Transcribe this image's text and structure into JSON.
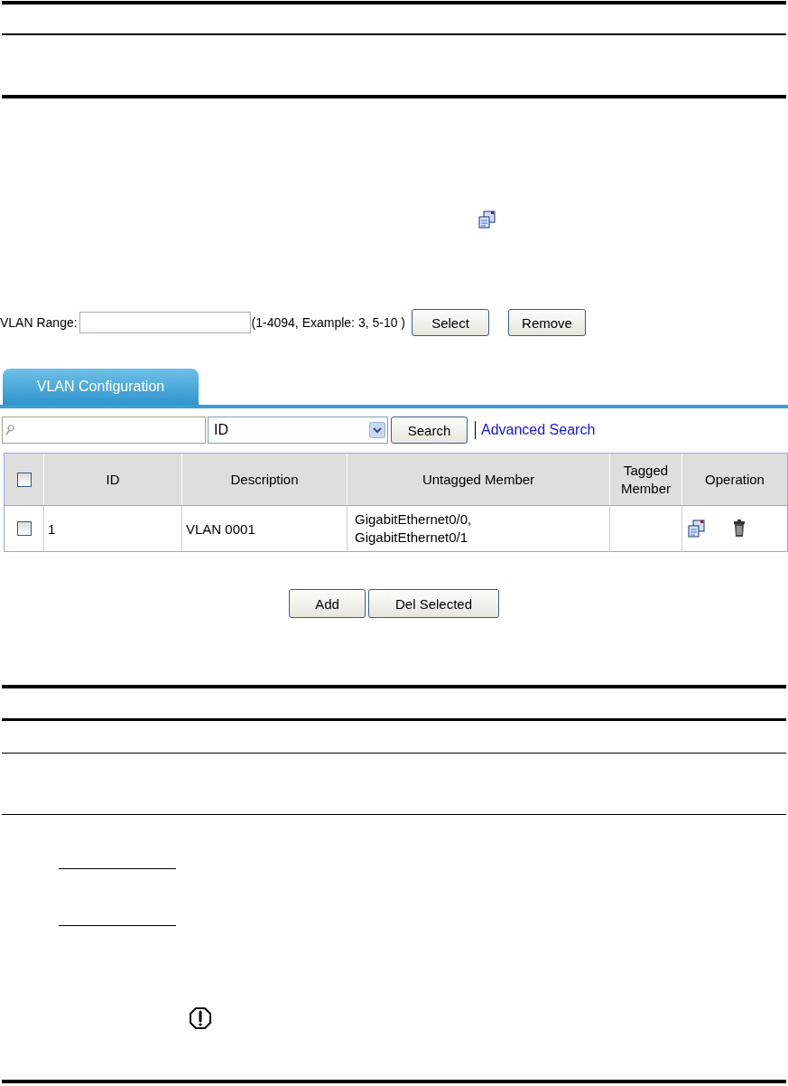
{
  "vlan_range": {
    "label": "VLAN Range:",
    "hint": "(1-4094, Example: 3, 5-10 )",
    "buttons": [
      "Select",
      "Remove"
    ]
  },
  "tabs": [
    {
      "label": "VLAN Configuration",
      "selected": true
    }
  ],
  "search": {
    "select_value": "ID",
    "button": "Search",
    "link": "Advanced Search"
  },
  "table": {
    "header_checked": false,
    "columns": [
      "ID",
      "Description",
      "Untagged Member",
      "Tagged Member",
      "Operation"
    ],
    "rows": [
      {
        "checked": false,
        "id": "1",
        "description": "VLAN 0001",
        "untagged": [
          "GigabitEthernet0/0,",
          "GigabitEthernet0/1"
        ]
      }
    ]
  },
  "buttons": [
    "Add",
    "Del Selected"
  ]
}
